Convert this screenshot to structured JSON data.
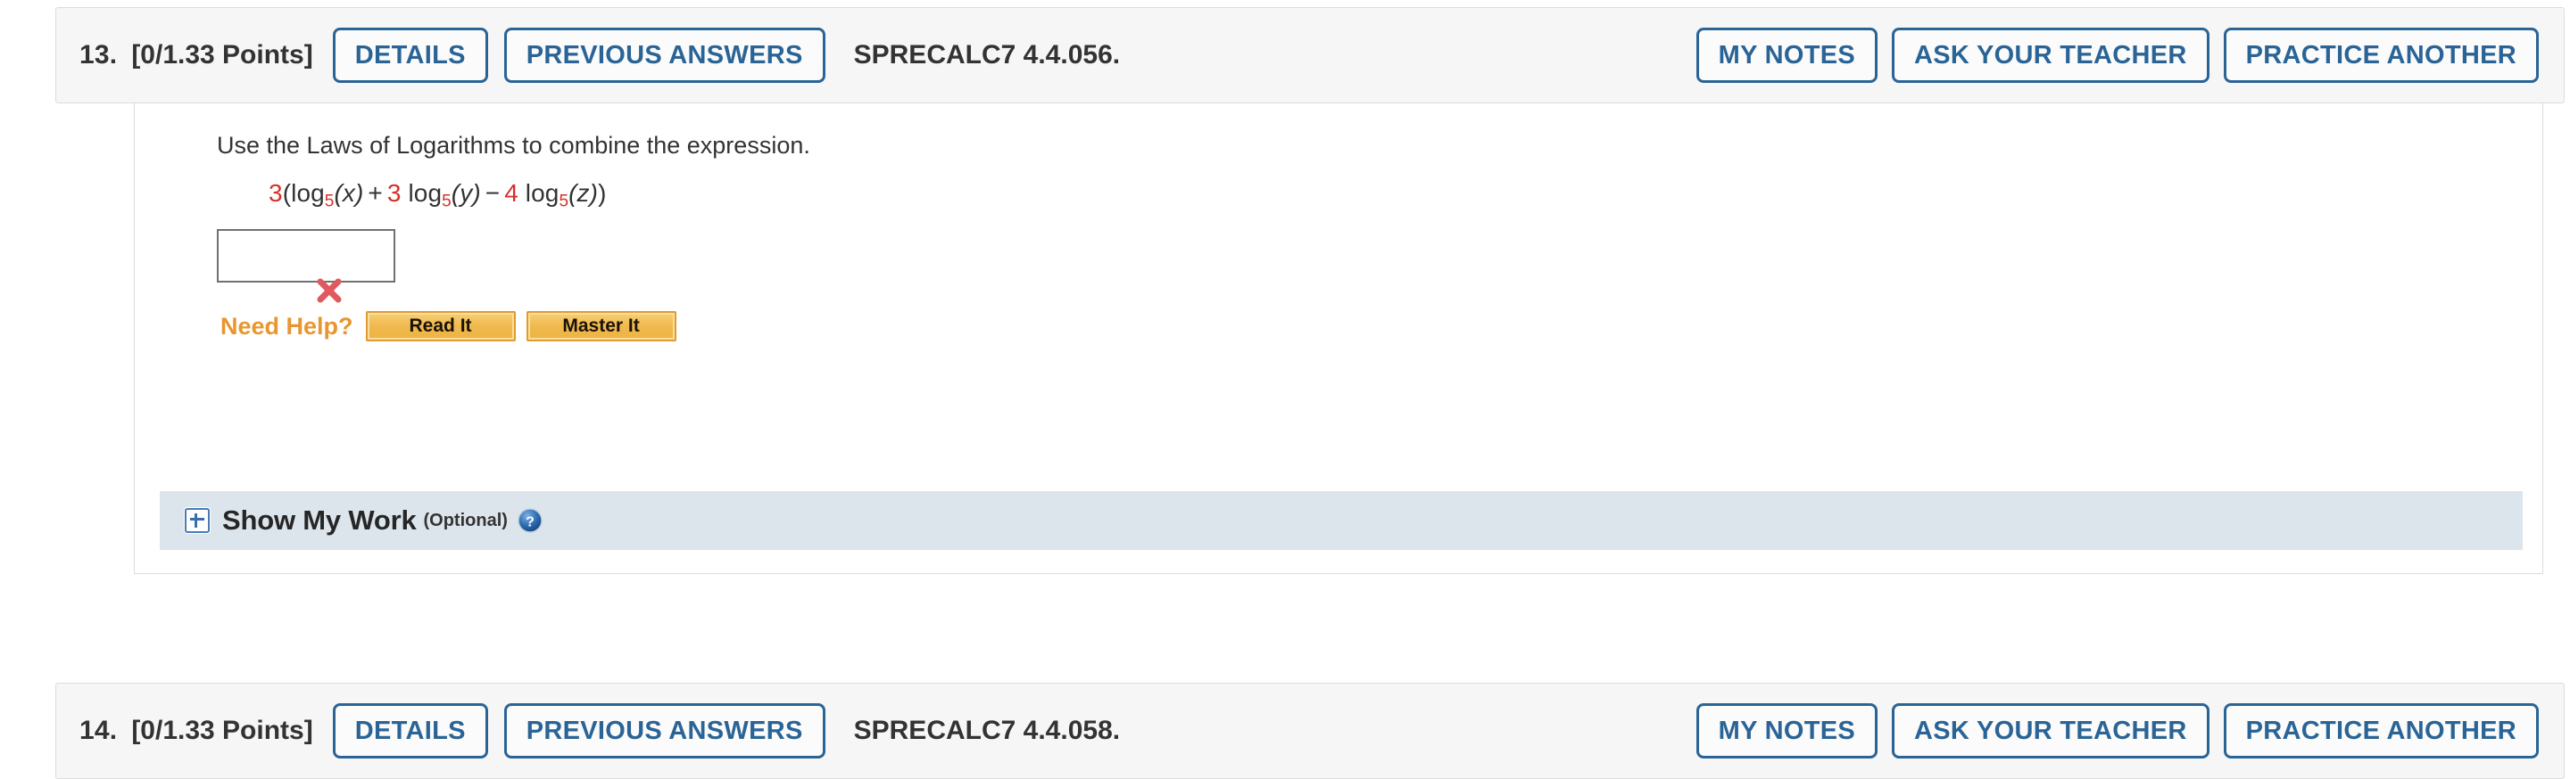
{
  "question": {
    "number": "13.",
    "points": "[0/1.33 Points]",
    "source": "SPRECALC7 4.4.056.",
    "buttons_left": [
      {
        "name": "details",
        "label": "DETAILS"
      },
      {
        "name": "previous-answers",
        "label": "PREVIOUS ANSWERS"
      }
    ],
    "buttons_right": [
      {
        "name": "my-notes",
        "label": "MY NOTES"
      },
      {
        "name": "ask-your-teacher",
        "label": "ASK YOUR TEACHER"
      },
      {
        "name": "practice-another",
        "label": "PRACTICE ANOTHER"
      }
    ],
    "prompt": "Use the Laws of Logarithms to combine the expression.",
    "expression": {
      "plain": "3(log5(x) + 3 log5(y) − 4 log5(z))",
      "outer_coefficient": "3",
      "open_paren": "(",
      "log1": "log",
      "base1": "5",
      "arg1": "(x)",
      "op1": "+",
      "coef2": "3",
      "log2": "log",
      "base2": "5",
      "arg2": "(y)",
      "op2": "−",
      "coef3": "4",
      "log3": "log",
      "base3": "5",
      "arg3": "(z)",
      "close_paren": ")"
    },
    "answer_input": {
      "value": "",
      "placeholder": ""
    },
    "result_mark": {
      "icon": "x-mark-incorrect-icon",
      "state": "incorrect",
      "color": "#e1595f"
    },
    "need_help": {
      "label": "Need Help?",
      "color": "#e8962f",
      "buttons": [
        {
          "name": "read-it",
          "label": "Read It"
        },
        {
          "name": "master-it",
          "label": "Master It"
        }
      ]
    },
    "show_my_work": {
      "expander_icon": "plus-box-icon",
      "title": "Show My Work",
      "optional": "(Optional)",
      "help_icon": "question-mark-help-icon",
      "bar_color": "#dde5ec"
    }
  },
  "next_question": {
    "number": "14.",
    "points": "[0/1.33 Points]",
    "source": "SPRECALC7 4.4.058.",
    "details_label": "DETAILS",
    "previous_answers_label": "PREVIOUS ANSWERS"
  },
  "theme": {
    "accent_blue": "#2a6496",
    "header_bg": "#f6f6f6",
    "border": "#dcdcdc",
    "red": "#d6302a",
    "gold": "#edb342"
  }
}
